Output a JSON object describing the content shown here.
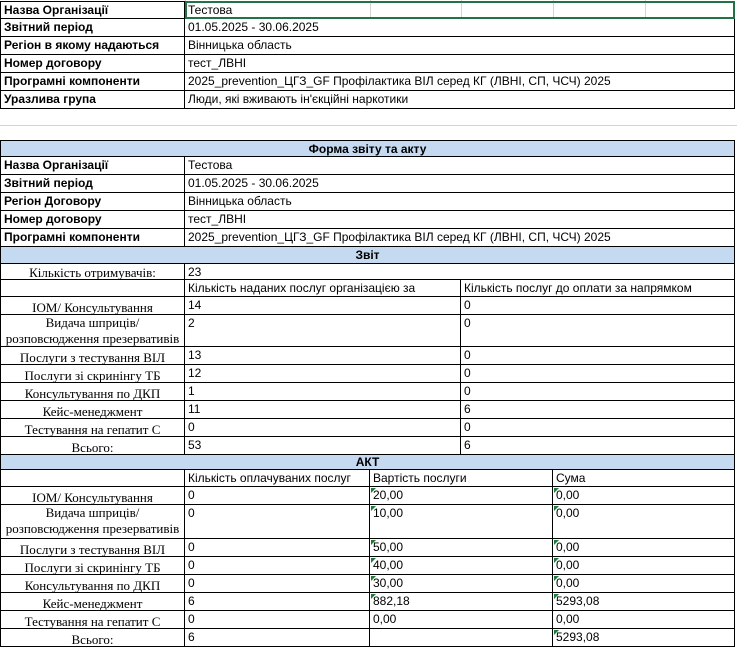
{
  "info_top": [
    {
      "label": "Назва Організації",
      "value": "Тестова"
    },
    {
      "label": "Звітний період",
      "value": "01.05.2025 - 30.06.2025"
    },
    {
      "label": "Регіон в якому надаються",
      "value": "Вінницька область"
    },
    {
      "label": "Номер договору",
      "value": "тест_ЛВНІ"
    },
    {
      "label": "Програмні компоненти",
      "value": "2025_prevention_ЦГЗ_GF Профілактика ВІЛ серед КГ (ЛВНІ, СП, ЧСЧ) 2025"
    },
    {
      "label": "Уразлива група",
      "value": "Люди, які вживають ін'єкційні наркотики"
    }
  ],
  "form_title": "Форма звіту та акту",
  "info_form": [
    {
      "label": "Назва Організації",
      "value": "Тестова"
    },
    {
      "label": "Звітний період",
      "value": "01.05.2025 - 30.06.2025"
    },
    {
      "label": "Регіон Договору",
      "value": "Вінницька область"
    },
    {
      "label": "Номер договору",
      "value": "тест_ЛВНІ"
    },
    {
      "label": "Програмні компоненти",
      "value": "2025_prevention_ЦГЗ_GF Профілактика ВІЛ серед КГ (ЛВНІ, СП, ЧСЧ) 2025"
    }
  ],
  "report": {
    "title": "Звіт",
    "recipients_label": "Кількість отримувачів:",
    "recipients_value": "23",
    "col1": "Кількість наданих послуг організацією за",
    "col2": "Кількість послуг до оплати за напрямком",
    "rows": [
      {
        "name": "ІОМ/ Консультування",
        "provided": "14",
        "to_pay": "0"
      },
      {
        "name": "Видача шприців/ розповсюдження презервативів",
        "provided": "2",
        "to_pay": "0"
      },
      {
        "name": "Послуги з тестування ВІЛ",
        "provided": "13",
        "to_pay": "0"
      },
      {
        "name": "Послуги зі скринінгу ТБ",
        "provided": "12",
        "to_pay": "0"
      },
      {
        "name": "Консультування по ДКП",
        "provided": "1",
        "to_pay": "0"
      },
      {
        "name": "Кейс-менеджмент",
        "provided": "11",
        "to_pay": "6"
      },
      {
        "name": "Тестування на гепатит С",
        "provided": "0",
        "to_pay": "0"
      }
    ],
    "total_label": "Всього:",
    "total_provided": "53",
    "total_to_pay": "6"
  },
  "act": {
    "title": "АКТ",
    "col1": "Кількість оплачуваних послуг",
    "col2": "Вартість послуги",
    "col3": "Сума",
    "rows": [
      {
        "name": "ІОМ/ Консультування",
        "qty": "0",
        "price": "20,00",
        "sum": "0,00"
      },
      {
        "name": "Видача шприців/ розповсюдження презервативів",
        "qty": "0",
        "price": "10,00",
        "sum": "0,00"
      },
      {
        "name": "Послуги з тестування ВІЛ",
        "qty": "0",
        "price": "50,00",
        "sum": "0,00"
      },
      {
        "name": "Послуги зі скринінгу ТБ",
        "qty": "0",
        "price": "40,00",
        "sum": "0,00"
      },
      {
        "name": "Консультування по ДКП",
        "qty": "0",
        "price": "30,00",
        "sum": "0,00"
      },
      {
        "name": "Кейс-менеджмент",
        "qty": "6",
        "price": "882,18",
        "sum": "5293,08"
      },
      {
        "name": "Тестування на гепатит С",
        "qty": "0",
        "price": "0,00",
        "sum": "0,00"
      }
    ],
    "total_label": "Всього:",
    "total_qty": "6",
    "total_sum": "5293,08"
  }
}
